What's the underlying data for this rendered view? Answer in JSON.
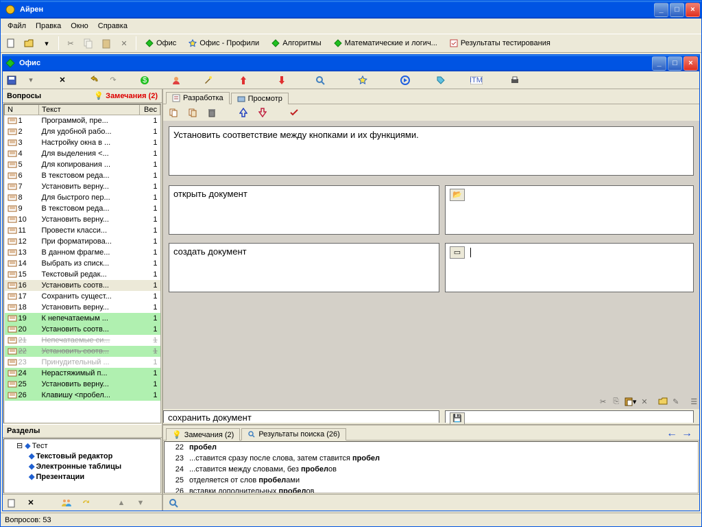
{
  "outer": {
    "title": "Айрен"
  },
  "menu": [
    "Файл",
    "Правка",
    "Окно",
    "Справка"
  ],
  "docs": [
    {
      "label": "Офис",
      "icon": "diamond-green"
    },
    {
      "label": "Офис - Профили",
      "icon": "star-blue"
    },
    {
      "label": "Алгоритмы",
      "icon": "diamond-green"
    },
    {
      "label": "Математические и логич...",
      "icon": "diamond-green"
    },
    {
      "label": "Результаты тестирования",
      "icon": "results"
    }
  ],
  "inner": {
    "title": "Офис"
  },
  "left": {
    "questions_header": "Вопросы",
    "notes_label": "Замечания (2)",
    "col_n": "N",
    "col_text": "Текст",
    "col_w": "Вес"
  },
  "questions": [
    {
      "n": 1,
      "text": "Программой, пре...",
      "w": 1
    },
    {
      "n": 2,
      "text": "Для удобной рабо...",
      "w": 1
    },
    {
      "n": 3,
      "text": "Настройку окна в ...",
      "w": 1
    },
    {
      "n": 4,
      "text": "Для выделения <...",
      "w": 1
    },
    {
      "n": 5,
      "text": "Для копирования ...",
      "w": 1
    },
    {
      "n": 6,
      "text": "В текстовом реда...",
      "w": 1
    },
    {
      "n": 7,
      "text": "Установить верну...",
      "w": 1
    },
    {
      "n": 8,
      "text": "Для быстрого пер...",
      "w": 1
    },
    {
      "n": 9,
      "text": "В текстовом реда...",
      "w": 1
    },
    {
      "n": 10,
      "text": "Установить верну...",
      "w": 1
    },
    {
      "n": 11,
      "text": "Провести класси...",
      "w": 1
    },
    {
      "n": 12,
      "text": "При форматирова...",
      "w": 1
    },
    {
      "n": 13,
      "text": "В данном фрагме...",
      "w": 1
    },
    {
      "n": 14,
      "text": "Выбрать из списк...",
      "w": 1
    },
    {
      "n": 15,
      "text": "Текстовый редак...",
      "w": 1
    },
    {
      "n": 16,
      "text": "Установить соотв...",
      "w": 1,
      "sel": true
    },
    {
      "n": 17,
      "text": "Сохранить сущест...",
      "w": 1
    },
    {
      "n": 18,
      "text": "Установить верну...",
      "w": 1
    },
    {
      "n": 19,
      "text": "К непечатаемым ...",
      "w": 1,
      "green": true
    },
    {
      "n": 20,
      "text": "Установить соотв...",
      "w": 1,
      "green": true
    },
    {
      "n": 21,
      "text": "Непечатаемые си...",
      "w": 1,
      "strike": true,
      "gray": true
    },
    {
      "n": 22,
      "text": "Установить соотв...",
      "w": 1,
      "green": true,
      "strike": true
    },
    {
      "n": 23,
      "text": "Принудительный ...",
      "w": 1,
      "gray": true
    },
    {
      "n": 24,
      "text": "Нерастяжимый п...",
      "w": 1,
      "green": true
    },
    {
      "n": 25,
      "text": "Установить верну...",
      "w": 1,
      "green": true
    },
    {
      "n": 26,
      "text": "Клавишу <пробел...",
      "w": 1,
      "green": true
    }
  ],
  "sections": {
    "header": "Разделы",
    "root": "Тест",
    "items": [
      "Текстовый редактор",
      "Электронные таблицы",
      "Презентации"
    ]
  },
  "tabs": {
    "dev": "Разработка",
    "view": "Просмотр"
  },
  "editor": {
    "question": "Установить соответствие между кнопками и их функциями.",
    "pairs": [
      {
        "left": "открыть документ",
        "right_icon": "folder-open"
      },
      {
        "left": "создать документ",
        "right_icon": "new-doc",
        "cursor": true
      },
      {
        "left": "сохранить документ",
        "right_icon": "floppy"
      }
    ]
  },
  "bottom": {
    "tab_notes": "Замечания (2)",
    "tab_search": "Результаты поиска (26)",
    "rows": [
      {
        "n": 22,
        "pre": "",
        "word": "пробел",
        "post": ""
      },
      {
        "n": 23,
        "pre": "...ставится сразу после слова, затем ставится ",
        "word": "пробел",
        "post": ""
      },
      {
        "n": 24,
        "pre": "...ставится между словами, без ",
        "word": "пробел",
        "post": "ов"
      },
      {
        "n": 25,
        "pre": "отделяется от слов ",
        "word": "пробел",
        "post": "ами"
      },
      {
        "n": 26,
        "pre": "вставки дополнительных ",
        "word": "пробел",
        "post": "ов"
      }
    ]
  },
  "status": "Вопросов: 53"
}
